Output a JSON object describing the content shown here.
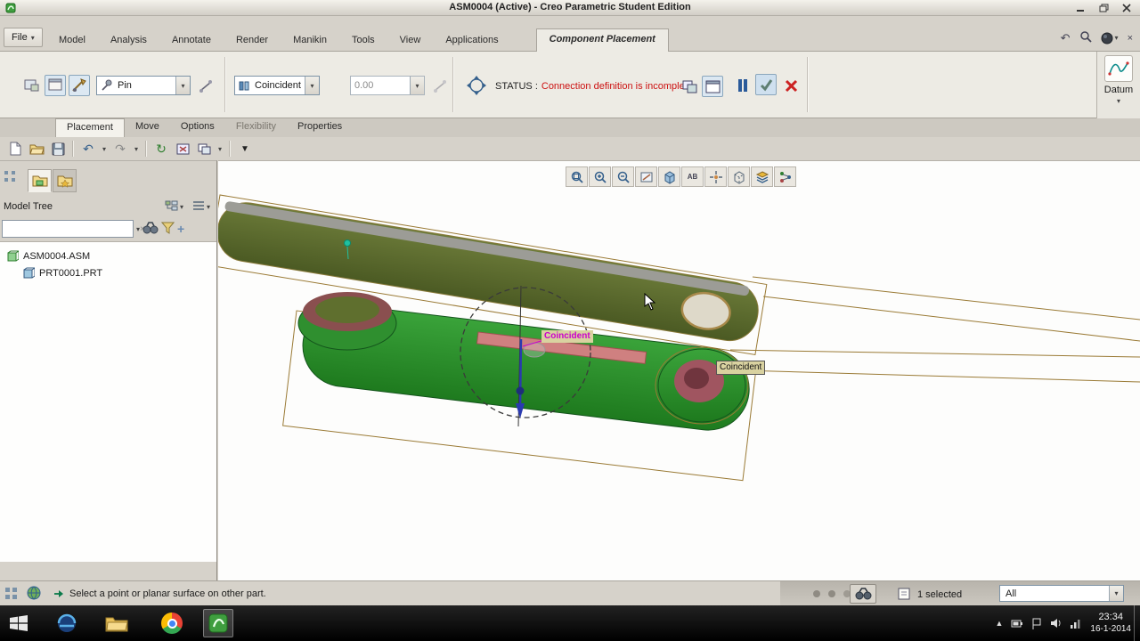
{
  "window": {
    "title": "ASM0004 (Active) - Creo Parametric Student Edition"
  },
  "menu": {
    "file_label": "File",
    "tabs": [
      "Model",
      "Analysis",
      "Annotate",
      "Render",
      "Manikin",
      "Tools",
      "View",
      "Applications"
    ],
    "active_tab": "Component Placement"
  },
  "ribbon": {
    "pin_label": "Pin",
    "constraint_label": "Coincident",
    "offset_value": "0.00",
    "status_label": "STATUS :",
    "status_message": "Connection definition is incomplete.",
    "subtabs": [
      "Placement",
      "Move",
      "Options",
      "Flexibility",
      "Properties"
    ],
    "datum_label": "Datum"
  },
  "model_tree": {
    "title": "Model Tree",
    "items": [
      {
        "label": "ASM0004.ASM"
      },
      {
        "label": "PRT0001.PRT"
      }
    ]
  },
  "graphics": {
    "constraint_label_1": "Coincident",
    "constraint_label_2": "Coincident"
  },
  "status_bar": {
    "message": "Select a point or planar surface on other part.",
    "selected_text": "1 selected",
    "filter_value": "All"
  },
  "taskbar": {
    "clock_time": "23:34",
    "clock_date": "16-1-2014"
  },
  "colors": {
    "status_message_red": "#cc1111",
    "constraint_magenta": "#cc00cc",
    "part_green": "#2f8f2f",
    "part_olive": "#5c6b2e",
    "label_bg": "#d9d2a0"
  }
}
